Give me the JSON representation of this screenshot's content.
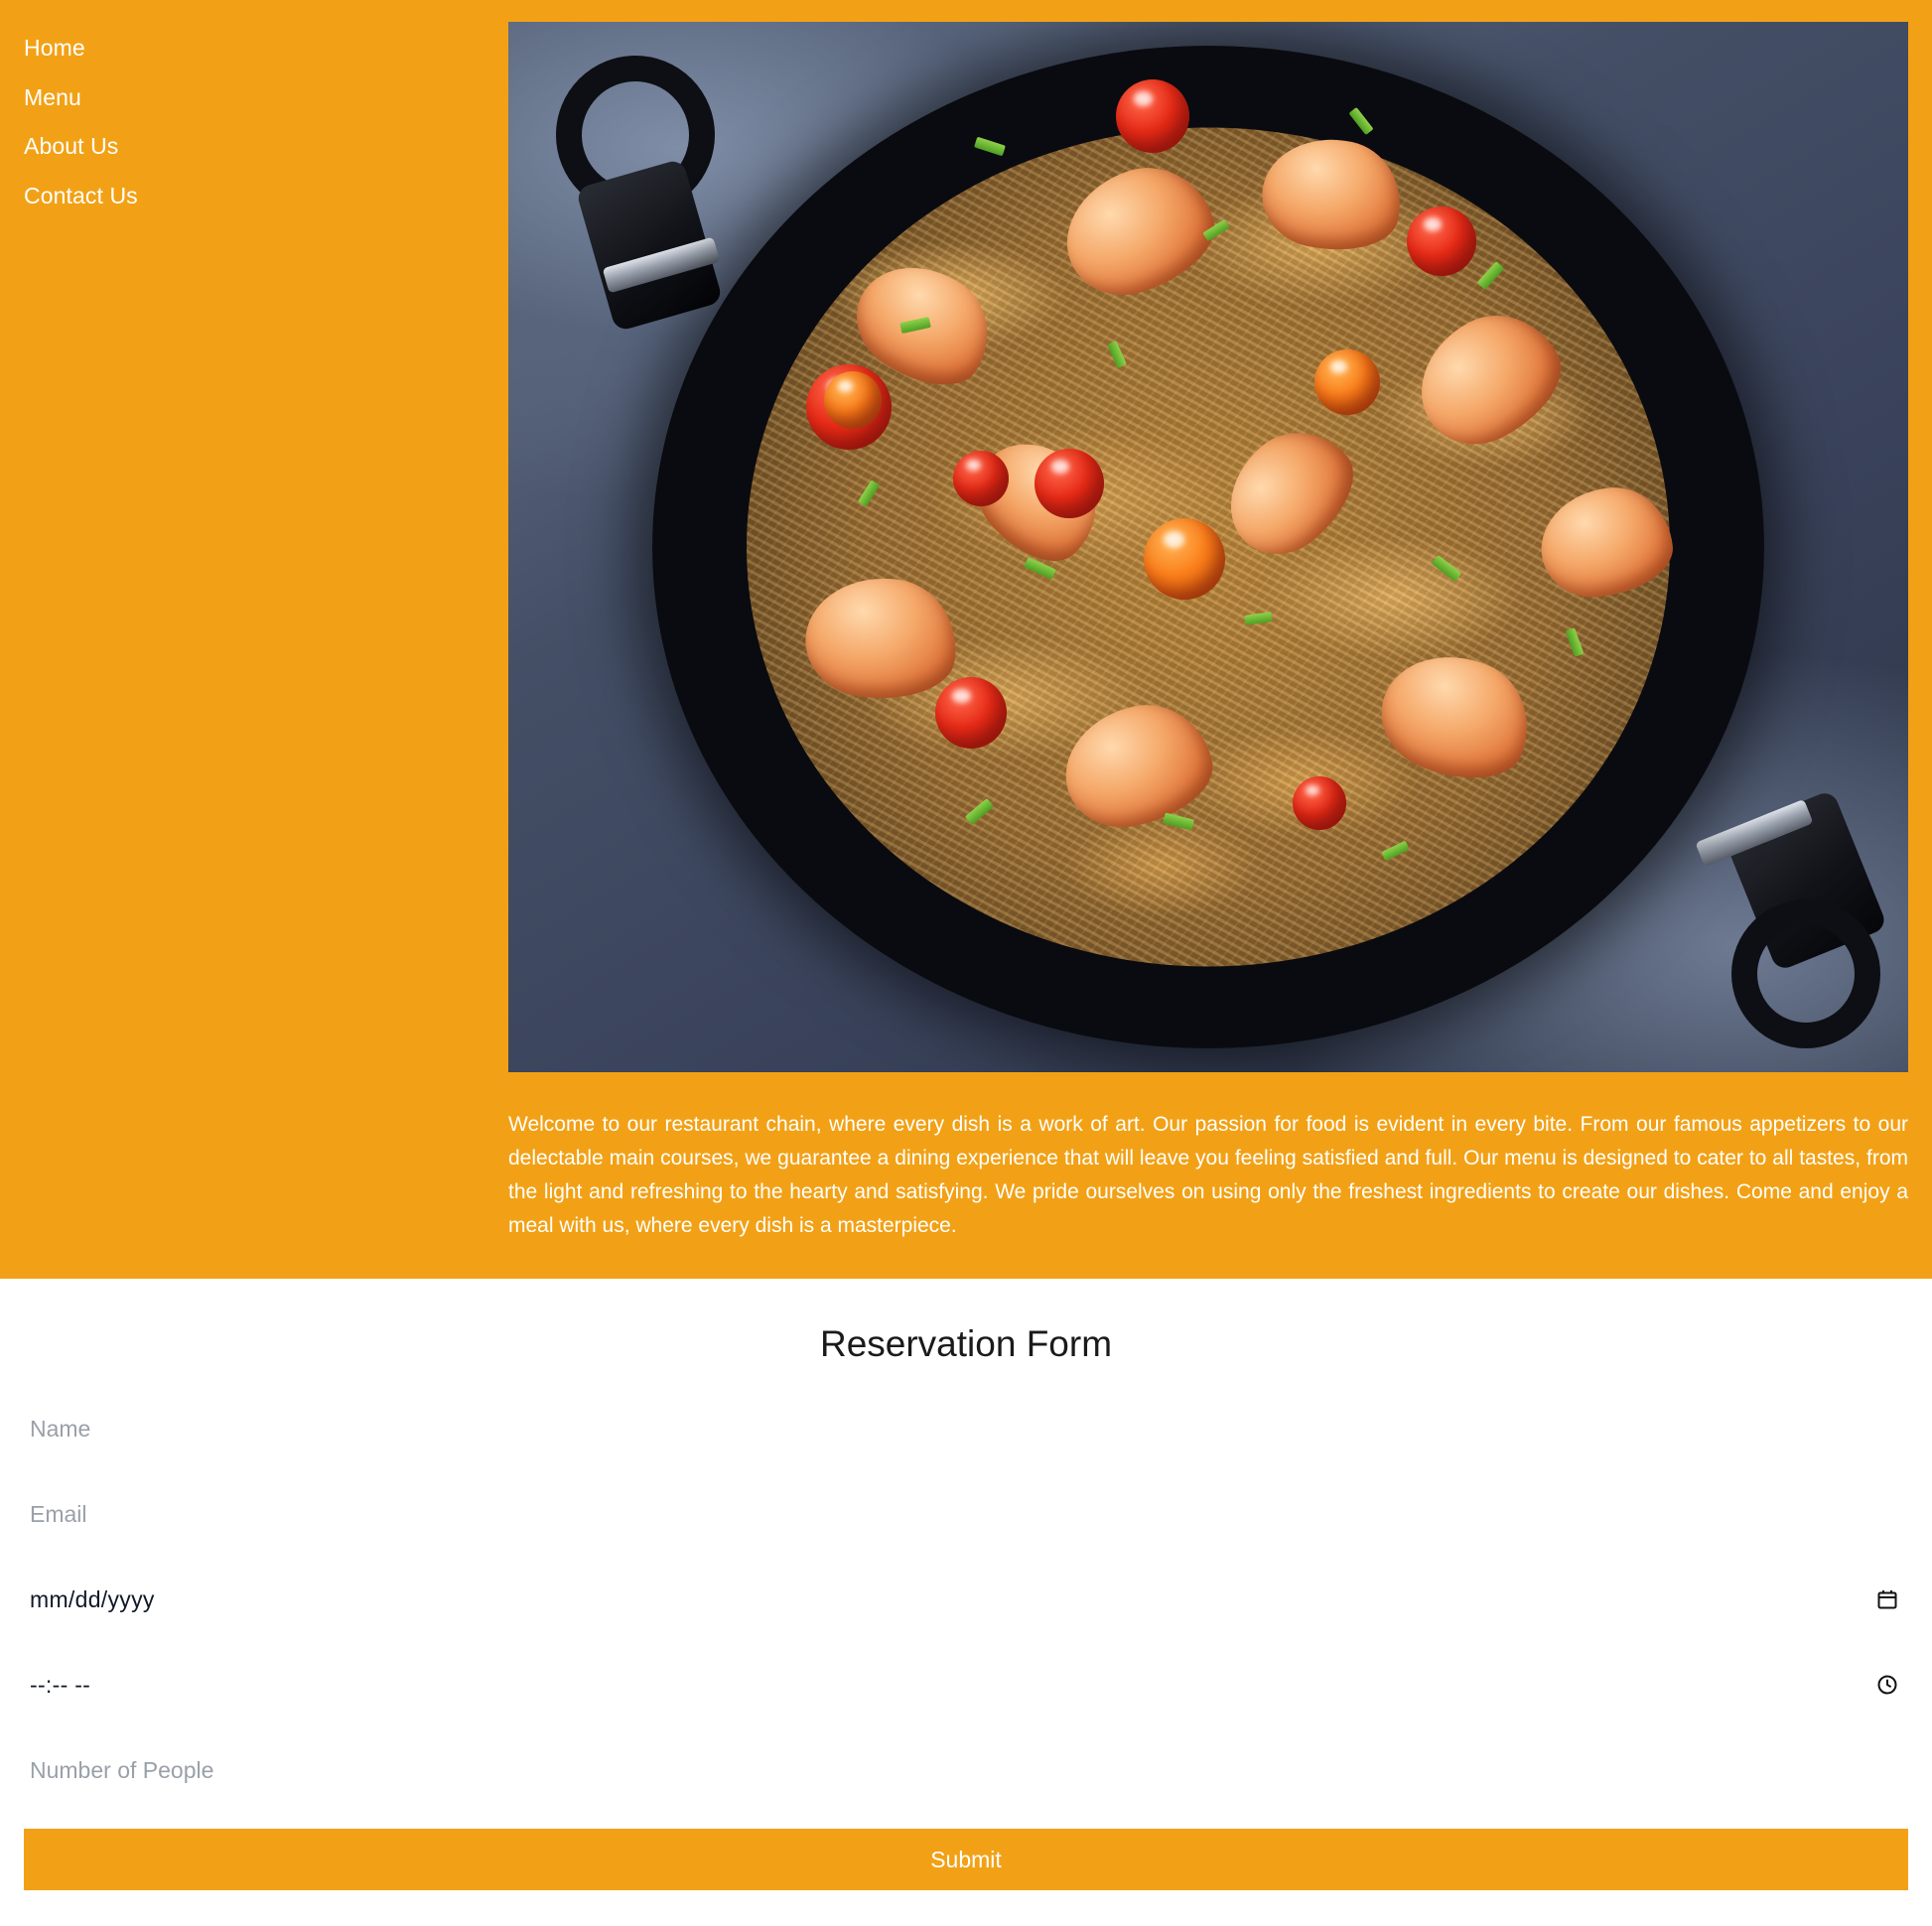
{
  "theme": {
    "accent": "#f2a116",
    "hero_text": "#ffffff",
    "form_bg": "#ffffff",
    "heading_color": "#1a1a1a",
    "placeholder_color": "#9aa0a8"
  },
  "sidebar": {
    "items": [
      {
        "label": "Home"
      },
      {
        "label": "Menu"
      },
      {
        "label": "About Us"
      },
      {
        "label": "Contact Us"
      }
    ]
  },
  "hero": {
    "image_alt": "Shrimp and vegetable spaghetti served in a dark cast-iron skillet on a slate surface",
    "welcome_text": "Welcome to our restaurant chain, where every dish is a work of art. Our passion for food is evident in every bite. From our famous appetizers to our delectable main courses, we guarantee a dining experience that will leave you feeling satisfied and full. Our menu is designed to cater to all tastes, from the light and refreshing to the hearty and satisfying. We pride ourselves on using only the freshest ingredients to create our dishes. Come and enjoy a meal with us, where every dish is a masterpiece."
  },
  "reservation_form": {
    "title": "Reservation Form",
    "fields": {
      "name_placeholder": "Name",
      "email_placeholder": "Email",
      "date_value": "mm/dd/yyyy",
      "time_value": "--:-- --",
      "people_placeholder": "Number of People"
    },
    "icons": {
      "date": "calendar-icon",
      "time": "clock-icon"
    },
    "submit_label": "Submit"
  }
}
